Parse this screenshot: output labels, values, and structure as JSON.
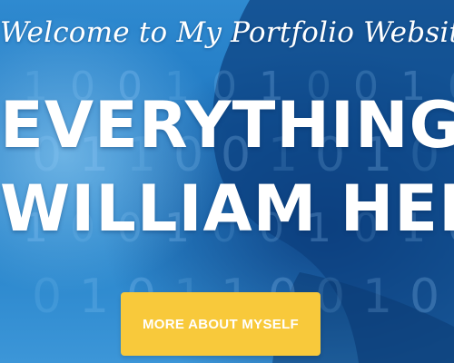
{
  "hero": {
    "welcome_text": "Welcome to My Portfolio Website!",
    "headline_line1": "EVERYTHING ABOUT",
    "headline_line2": "WILLIAM HERE",
    "cta_label": "MORE ABOUT MYSELF"
  },
  "theme": {
    "background": "#1f78c2",
    "accent": "#f8c93b",
    "text": "#ffffff"
  },
  "background_pattern": {
    "digits": [
      "1",
      "0",
      "0",
      "1",
      "0",
      "1",
      "0",
      "0",
      "1",
      "0",
      "0",
      "1",
      "1",
      "0",
      "0",
      "1",
      "0",
      "1",
      "0",
      "1",
      "1",
      "0",
      "0",
      "1",
      "0",
      "0",
      "1",
      "0",
      "1",
      "0",
      "0",
      "1",
      "0",
      "1",
      "1",
      "0",
      "0",
      "1",
      "0",
      "1"
    ]
  }
}
